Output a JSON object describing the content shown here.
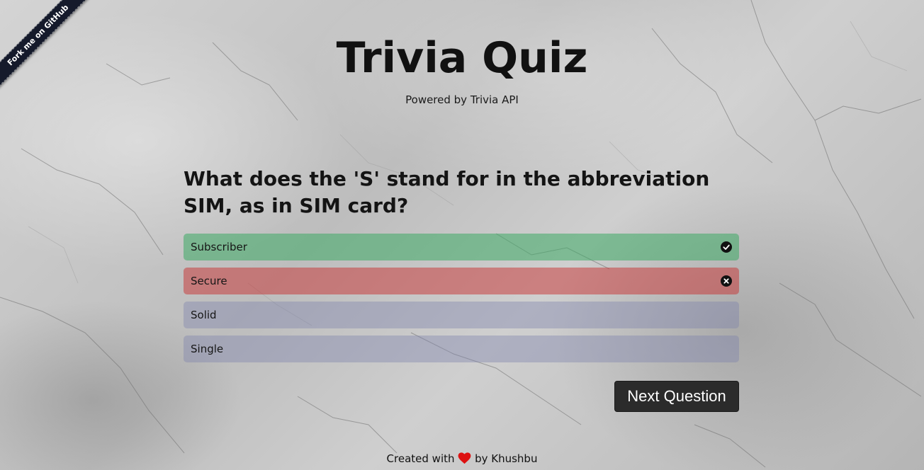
{
  "ribbon": {
    "label": "Fork me on GitHub"
  },
  "header": {
    "title": "Trivia Quiz",
    "subtitle": "Powered by Trivia API"
  },
  "quiz": {
    "question": "What does the 'S' stand for in the abbreviation SIM, as in SIM card?",
    "answers": [
      {
        "label": "Subscriber",
        "state": "correct",
        "icon": "check-circle-icon"
      },
      {
        "label": "Secure",
        "state": "wrong",
        "icon": "x-circle-icon"
      },
      {
        "label": "Solid",
        "state": "neutral"
      },
      {
        "label": "Single",
        "state": "neutral"
      }
    ],
    "next_label": "Next Question"
  },
  "footer": {
    "prefix": "Created with",
    "icon": "heart-icon",
    "suffix": "by Khushbu"
  },
  "colors": {
    "correct": "#3caa64",
    "wrong": "#c83232",
    "neutral": "#787daa",
    "button": "#2b2b2b",
    "ribbon": "#151a2b",
    "heart": "#dd1111"
  }
}
